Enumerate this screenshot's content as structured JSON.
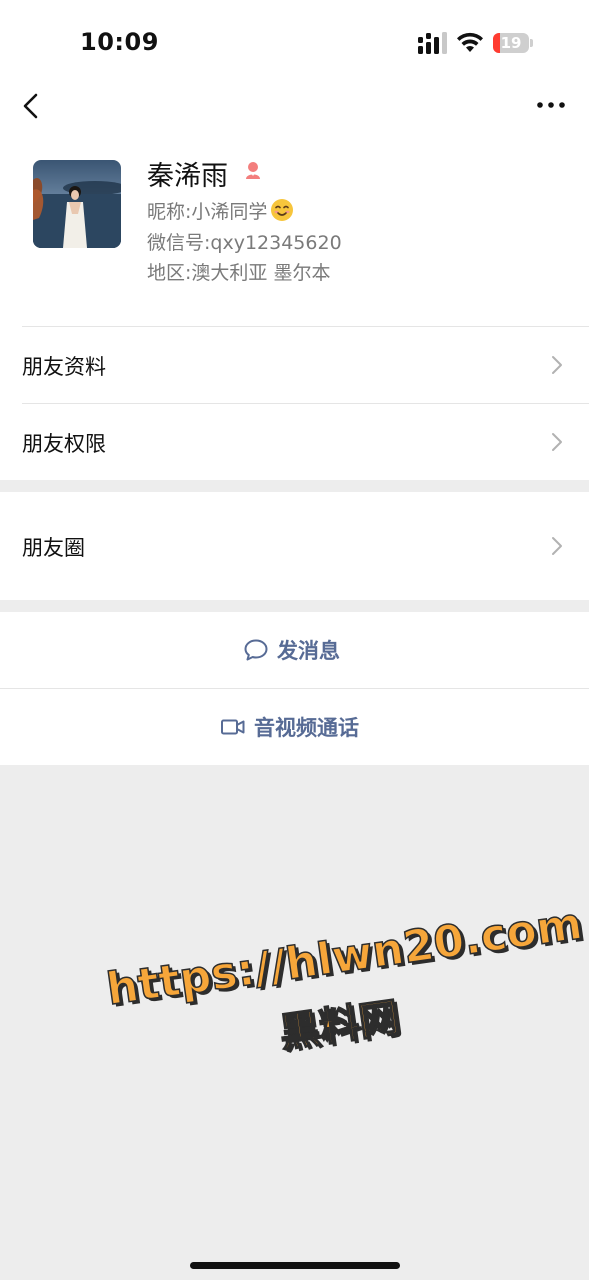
{
  "status_bar": {
    "time": "10:09",
    "battery_level": "19",
    "icons": [
      "signal-icon",
      "wifi-icon",
      "battery-icon"
    ],
    "battery_color": "#ff3b30"
  },
  "nav": {
    "back_icon": "chevron-left-icon",
    "more_icon": "more-horizontal-icon"
  },
  "profile": {
    "name": "秦浠雨",
    "gender_icon": "female-icon",
    "gender_color": "#f37e7d",
    "nickname_label": "昵称:",
    "nickname": "小浠同学",
    "nickname_emoji": "smile-emoji-icon",
    "wechat_id_label": "微信号:",
    "wechat_id": "qxy12345620",
    "region_label": "地区:",
    "region": "澳大利亚 墨尔本"
  },
  "menu": {
    "items": [
      {
        "label": "朋友资料"
      },
      {
        "label": "朋友权限"
      },
      {
        "label": "朋友圈"
      }
    ]
  },
  "actions": {
    "message_label": "发消息",
    "call_label": "音视频通话",
    "accent_color": "#576b95"
  },
  "watermark": {
    "line1": "https://hlwn20.com",
    "line2": "黑料网"
  }
}
